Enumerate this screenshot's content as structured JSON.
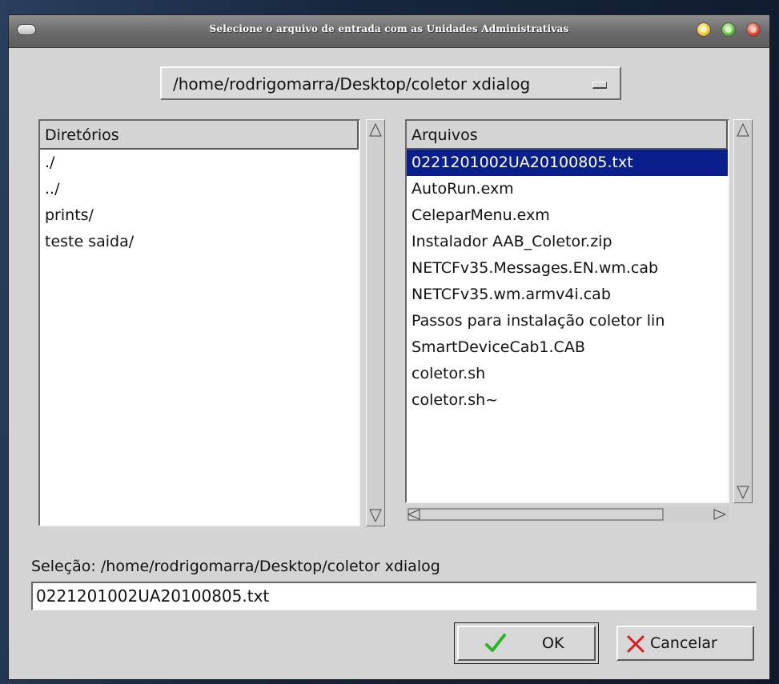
{
  "window": {
    "title": "Selecione o arquivo de entrada com as Unidades Administrativas"
  },
  "path_selector": {
    "value": "/home/rodrigomarra/Desktop/coletor xdialog"
  },
  "directories": {
    "header": "Diretórios",
    "items": [
      "./",
      "../",
      "prints/",
      "teste saida/"
    ]
  },
  "files": {
    "header": "Arquivos",
    "selected_index": 0,
    "items": [
      "0221201002UA20100805.txt",
      "AutoRun.exm",
      "CeleparMenu.exm",
      "Instalador AAB_Coletor.zip",
      "NETCFv35.Messages.EN.wm.cab",
      "NETCFv35.wm.armv4i.cab",
      "Passos para instalação coletor lin",
      "SmartDeviceCab1.CAB",
      "coletor.sh",
      "coletor.sh~"
    ]
  },
  "selection": {
    "label": "Seleção: /home/rodrigomarra/Desktop/coletor xdialog",
    "value": "0221201002UA20100805.txt"
  },
  "buttons": {
    "ok": "OK",
    "cancel": "Cancelar"
  },
  "icons": {
    "ok": "check-icon",
    "cancel": "x-icon"
  },
  "colors": {
    "selection_bg": "#0a1f8c",
    "check": "#2db52a",
    "cancel_x": "#e01a1a",
    "minimize": "#f2c230",
    "maximize": "#5fbf3a",
    "close": "#e8402b"
  }
}
